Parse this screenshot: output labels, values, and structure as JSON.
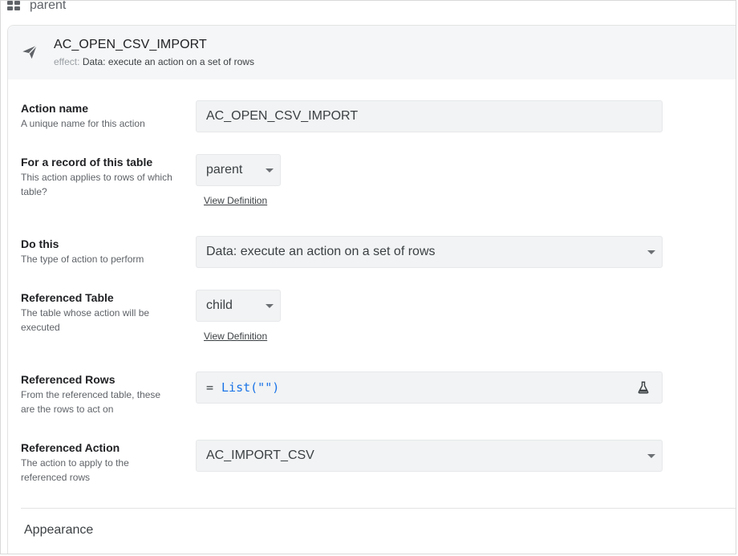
{
  "breadcrumb": {
    "table_icon": "table-grid-icon",
    "label": "parent"
  },
  "action": {
    "icon": "send-icon",
    "title": "AC_OPEN_CSV_IMPORT",
    "effect_prefix": "effect:",
    "effect_value": "Data: execute an action on a set of rows"
  },
  "fields": {
    "action_name": {
      "label": "Action name",
      "help": "A unique name for this action",
      "value": "AC_OPEN_CSV_IMPORT"
    },
    "record_table": {
      "label": "For a record of this table",
      "help": "This action applies to rows of which table?",
      "value": "parent",
      "link": "View Definition"
    },
    "do_this": {
      "label": "Do this",
      "help": "The type of action to perform",
      "value": "Data: execute an action on a set of rows"
    },
    "referenced_table": {
      "label": "Referenced Table",
      "help": "The table whose action will be executed",
      "value": "child",
      "link": "View Definition"
    },
    "referenced_rows": {
      "label": "Referenced Rows",
      "help": "From the referenced table, these are the rows to act on",
      "equals": "=",
      "formula": "List(\"\")",
      "test_icon": "flask-icon"
    },
    "referenced_action": {
      "label": "Referenced Action",
      "help": "The action to apply to the referenced rows",
      "value": "AC_IMPORT_CSV"
    }
  },
  "sections": {
    "appearance": "Appearance"
  }
}
